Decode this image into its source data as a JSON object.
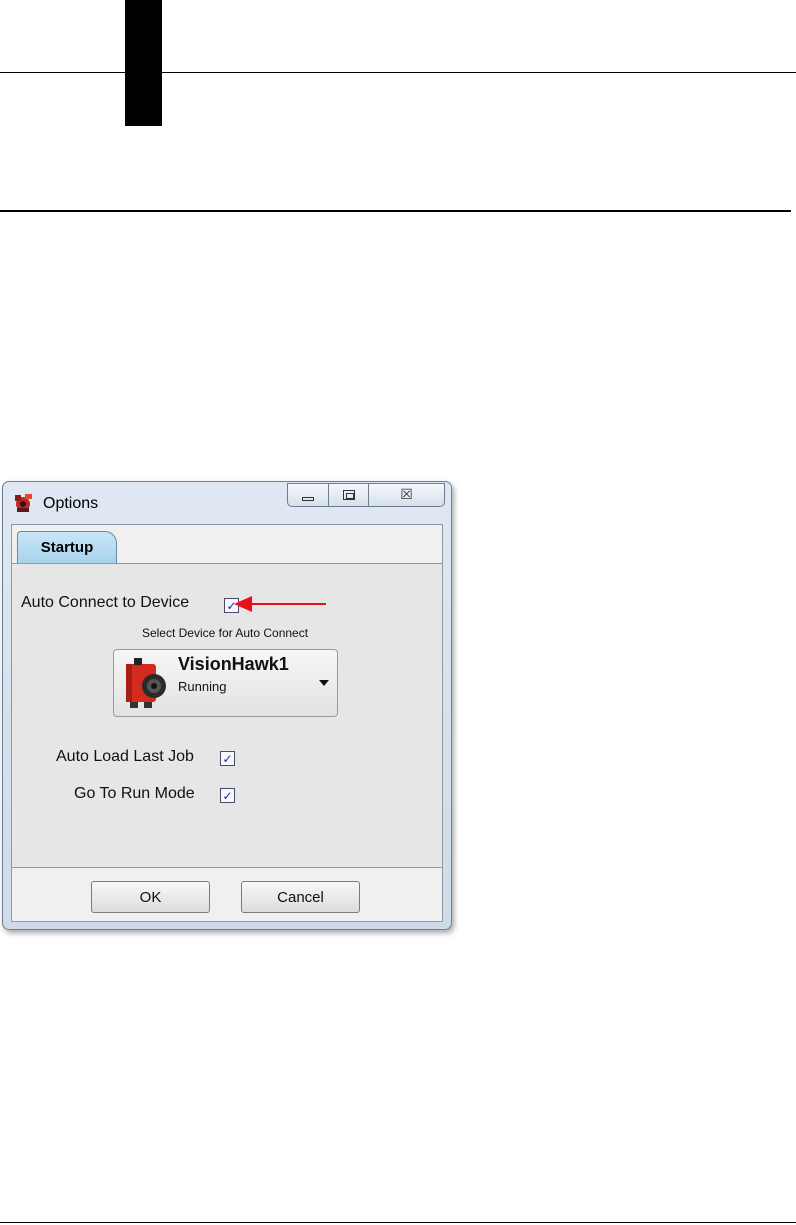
{
  "dialog": {
    "title": "Options",
    "icon": "app-logo-icon"
  },
  "window_controls": {
    "minimize_icon": "minimize-icon",
    "maximize_icon": "maximize-icon",
    "close_icon": "close-icon",
    "close_glyph": "☒"
  },
  "tabs": [
    {
      "label": "Startup",
      "selected": true
    }
  ],
  "startup": {
    "auto_connect": {
      "label": "Auto Connect to Device",
      "checked": true
    },
    "select_device_label": "Select Device for Auto Connect",
    "device": {
      "name": "VisionHawk1",
      "status": "Running",
      "icon": "camera-device-icon"
    },
    "auto_load_last_job": {
      "label": "Auto Load Last Job",
      "checked": true
    },
    "go_to_run_mode": {
      "label": "Go To Run Mode",
      "checked": true
    },
    "check_glyph": "✓"
  },
  "buttons": {
    "ok": "OK",
    "cancel": "Cancel"
  },
  "colors": {
    "annotation_arrow": "#e8101a",
    "tab_active": "#a7d3ec",
    "device_body": "#d52b1e"
  }
}
